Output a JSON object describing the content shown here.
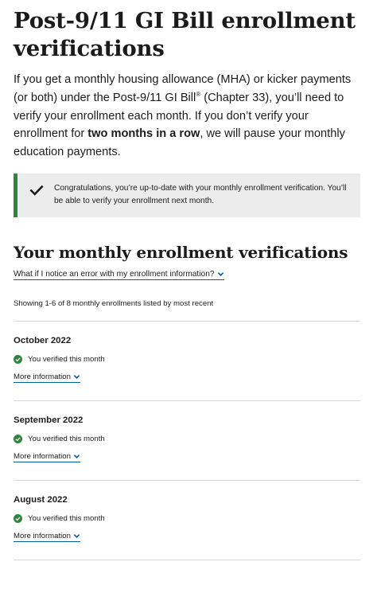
{
  "header": {
    "title": "Post-9/11 GI Bill enrollment verifications"
  },
  "intro": {
    "part1": "If you get a monthly housing allowance (MHA) or kicker payments (or both) under the Post-9/11 GI Bill",
    "registered_mark": "®",
    "part2": " (Chapter 33), you’ll need to verify your enrollment each month. If you don’t verify your enrollment for ",
    "bold": "two months in a row",
    "part3": ", we will pause your monthly education payments."
  },
  "alert": {
    "text": "Congratulations, you’re up-to-date with your monthly enrollment verification. You’ll be able to verify your enrollment next month.",
    "color": "#2e8540",
    "icon": "check-icon"
  },
  "verifications": {
    "heading": "Your monthly enrollment verifications",
    "error_link": "What if I notice an error with my enrollment information?",
    "showing": "Showing 1-6 of 8 monthly enrollments listed by most recent",
    "records": [
      {
        "month": "October 2022",
        "status": "You verified this month",
        "more": "More information"
      },
      {
        "month": "September 2022",
        "status": "You verified this month",
        "more": "More information"
      },
      {
        "month": "August 2022",
        "status": "You verified this month",
        "more": "More information"
      }
    ]
  },
  "colors": {
    "link_underline": "#005ea2",
    "chevron": "#005ea2",
    "success": "#2e8540"
  }
}
